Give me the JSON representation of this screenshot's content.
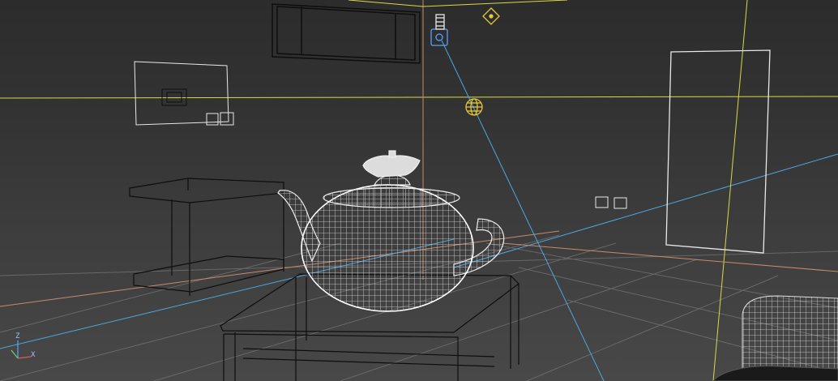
{
  "viewport": {
    "type": "3d-wireframe-perspective",
    "background": "#3a3a3a",
    "gizmo": {
      "axes": [
        "Z",
        "X"
      ]
    }
  },
  "colors": {
    "grid_x_axis": "#c98a6a",
    "grid_y_axis": "#4da6e0",
    "horizon_line": "#d8d84a",
    "wire_white": "#e8e8e8",
    "wire_dark": "#0e0e0e",
    "camera_blue": "#5aa0ff",
    "light_yellow": "#e6c83c"
  },
  "scene_objects": [
    {
      "name": "teapot",
      "kind": "mesh-wireframe"
    },
    {
      "name": "coffee-table",
      "kind": "mesh-wireframe"
    },
    {
      "name": "side-table",
      "kind": "mesh-wireframe"
    },
    {
      "name": "wall-shelf",
      "kind": "mesh-wireframe"
    },
    {
      "name": "wall-frame",
      "kind": "mesh-wireframe"
    },
    {
      "name": "door",
      "kind": "mesh-wireframe"
    },
    {
      "name": "armchair",
      "kind": "mesh-wireframe"
    },
    {
      "name": "camera",
      "kind": "helper"
    },
    {
      "name": "camera-target",
      "kind": "helper"
    },
    {
      "name": "omni-light",
      "kind": "helper"
    }
  ]
}
